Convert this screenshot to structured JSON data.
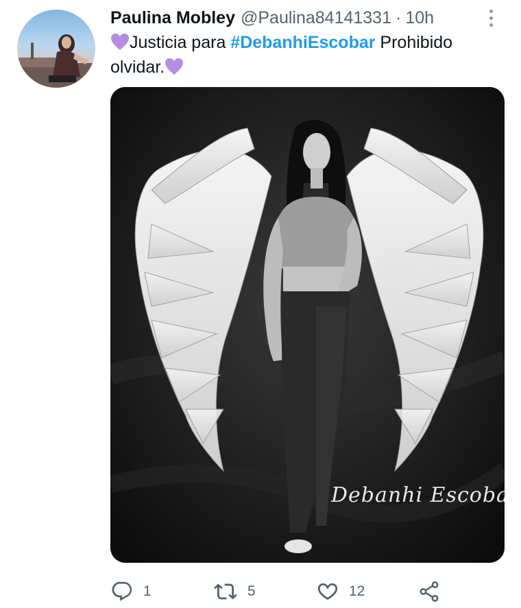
{
  "tweet": {
    "display_name": "Paulina Mobley",
    "handle": "@Paulina84141331",
    "separator": "·",
    "time": "10h",
    "text_before_hashtag": "Justicia para ",
    "hashtag": "#DebanhiEscobar",
    "text_after_hashtag": " Prohibido olvidar.",
    "emoji": "purple-heart",
    "image_watermark": "Debanhi Escobar"
  },
  "actions": {
    "reply_count": "1",
    "retweet_count": "5",
    "like_count": "12"
  },
  "colors": {
    "hashtag": "#1d9bf0",
    "secondary_text": "#536471",
    "emoji_heart": "#b48ee0"
  },
  "icons": [
    "more-icon",
    "reply-icon",
    "retweet-icon",
    "like-icon",
    "share-icon"
  ]
}
